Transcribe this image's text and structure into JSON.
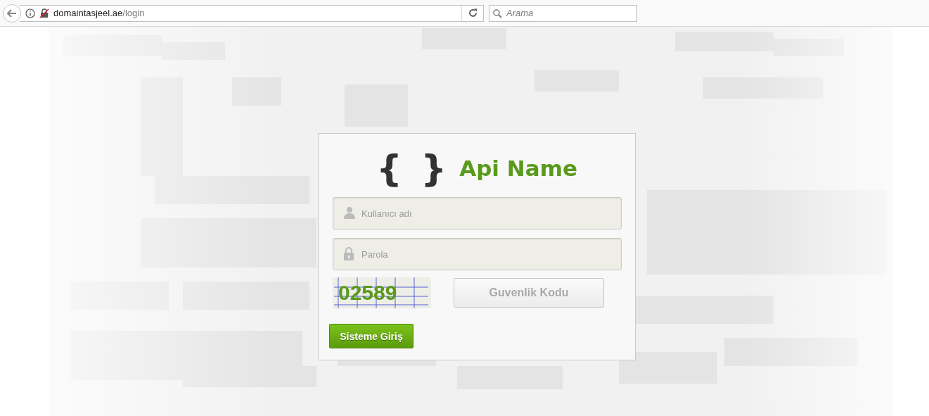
{
  "browser": {
    "url_host": "domaintasjeel.ae",
    "url_path": "/login",
    "search": {
      "placeholder": "Arama"
    }
  },
  "login": {
    "logo_mark": "{ }",
    "title": "Api Name",
    "fields": [
      {
        "kind": "user",
        "placeholder": "Kullanıcı adı"
      },
      {
        "kind": "lock",
        "placeholder": "Parola"
      }
    ],
    "captcha": {
      "code": "02589",
      "placeholder": "Guvenlik Kodu"
    },
    "submit": "Sisteme Giriş"
  }
}
